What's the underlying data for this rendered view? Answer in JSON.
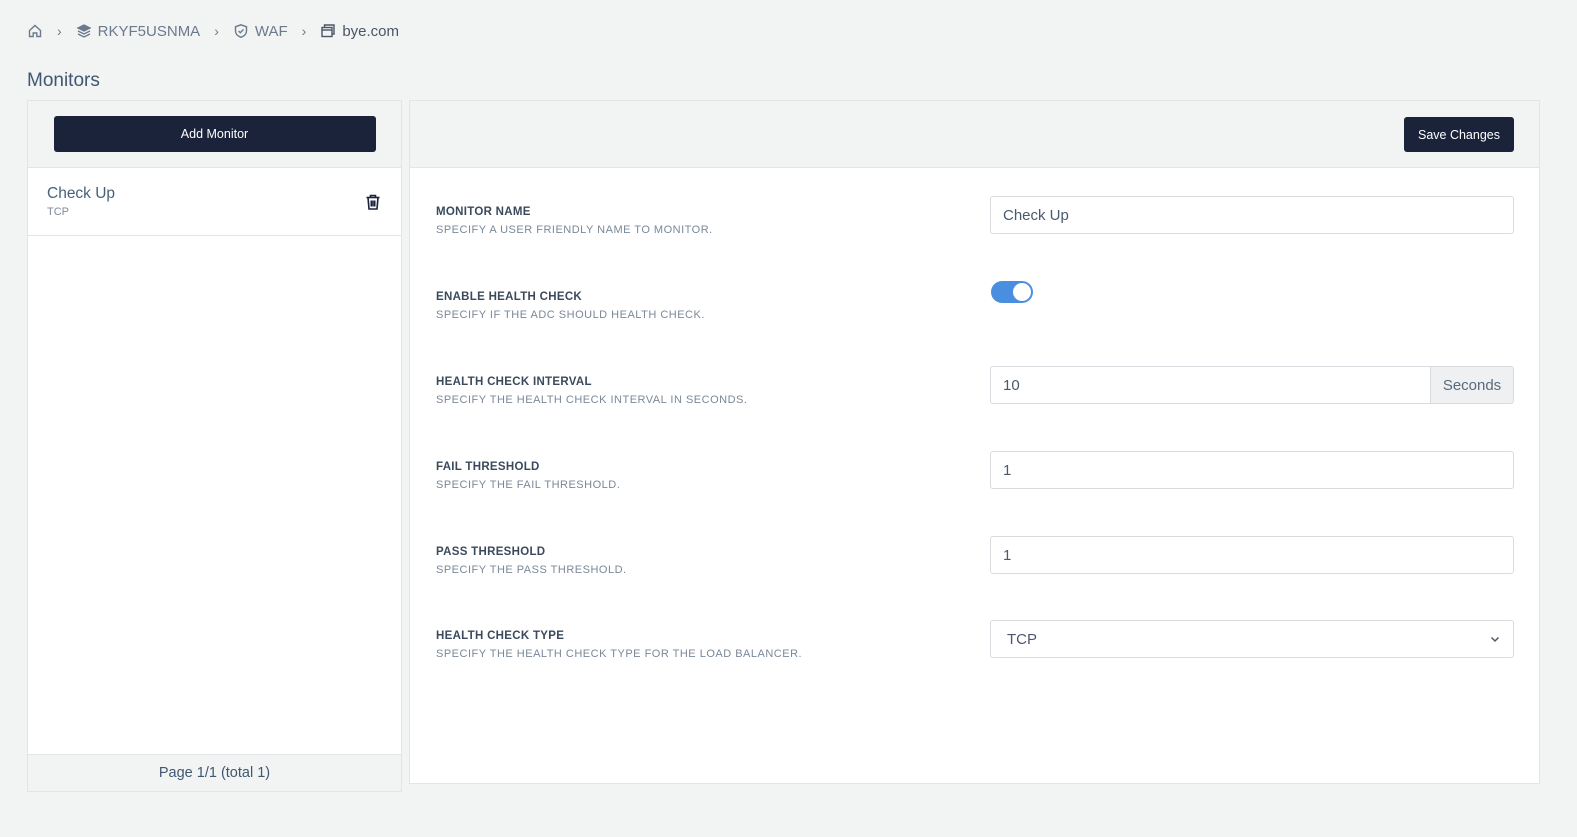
{
  "breadcrumb": {
    "home_icon": "home-icon",
    "item1": {
      "icon": "layers-icon",
      "label": "RKYF5USNMA"
    },
    "item2": {
      "icon": "shield-icon",
      "label": "WAF"
    },
    "item3": {
      "icon": "window-icon",
      "label": "bye.com"
    },
    "separator": "›"
  },
  "page": {
    "title": "Monitors"
  },
  "left_panel": {
    "add_button": "Add Monitor",
    "items": [
      {
        "name": "Check Up",
        "type": "TCP",
        "delete_icon": "trash-icon"
      }
    ],
    "footer": "Page 1/1 (total 1)"
  },
  "right_panel": {
    "save_button": "Save Changes",
    "fields": {
      "monitor_name": {
        "label": "MONITOR NAME",
        "desc": "SPECIFY A USER FRIENDLY NAME TO MONITOR.",
        "value": "Check Up"
      },
      "enable_health_check": {
        "label": "ENABLE HEALTH CHECK",
        "desc": "SPECIFY IF THE ADC SHOULD HEALTH CHECK.",
        "value": true
      },
      "interval": {
        "label": "HEALTH CHECK INTERVAL",
        "desc": "SPECIFY THE HEALTH CHECK INTERVAL IN SECONDS.",
        "value": "10",
        "unit": "Seconds"
      },
      "fail_threshold": {
        "label": "FAIL THRESHOLD",
        "desc": "SPECIFY THE FAIL THRESHOLD.",
        "value": "1"
      },
      "pass_threshold": {
        "label": "PASS THRESHOLD",
        "desc": "SPECIFY THE PASS THRESHOLD.",
        "value": "1"
      },
      "check_type": {
        "label": "HEALTH CHECK TYPE",
        "desc": "SPECIFY THE HEALTH CHECK TYPE FOR THE LOAD BALANCER.",
        "value": "TCP"
      }
    }
  },
  "colors": {
    "primary_dark": "#1a233a",
    "toggle_on": "#4a8ee0",
    "background": "#f2f3f3"
  }
}
